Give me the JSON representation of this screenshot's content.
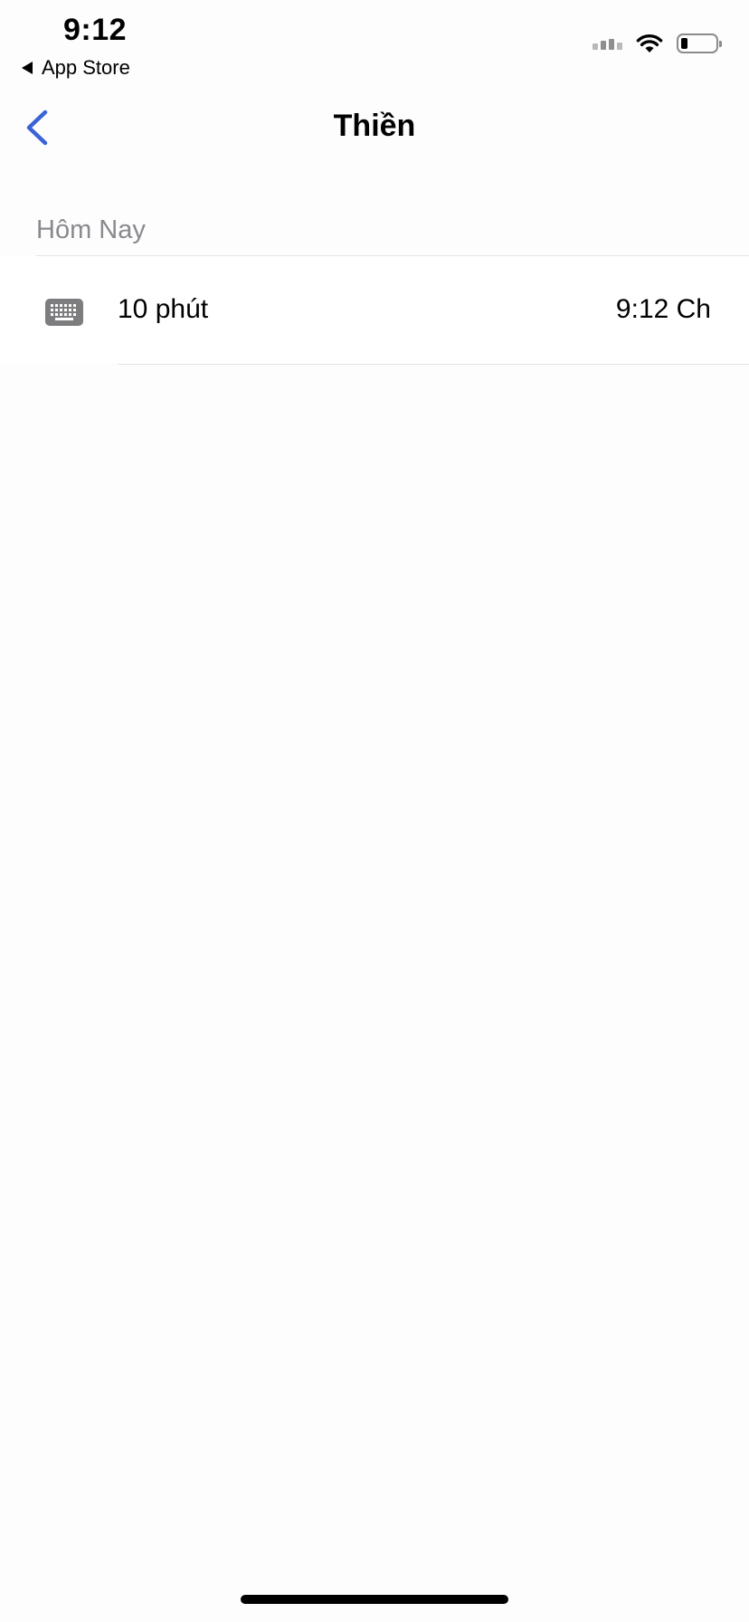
{
  "status_bar": {
    "time": "9:12",
    "back_app": "App Store",
    "battery_level": 0.2
  },
  "nav": {
    "title": "Thiền",
    "back_icon": "chevron-left-icon",
    "accent": "#3a63d8"
  },
  "section": {
    "header": "Hôm Nay",
    "rows": [
      {
        "icon": "keyboard-icon",
        "label": "10 phút",
        "value": "9:12 Ch"
      }
    ]
  }
}
